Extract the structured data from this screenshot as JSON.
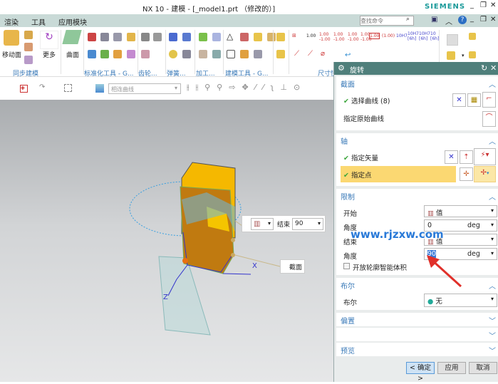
{
  "window": {
    "title": "NX 10 - 建模 - [_model1.prt （修改的）]",
    "brand": "SIEMENS"
  },
  "menu": {
    "items": [
      "渲染",
      "工具",
      "应用模块"
    ],
    "search_placeholder": "查找命令"
  },
  "ribbon": {
    "move_face": "移动面",
    "more": "更多",
    "surface": "曲面",
    "groups": [
      "同步建模",
      "标准化工具 - G...",
      "齿轮...",
      "弹簧...",
      "加工...",
      "建模工具 - G...",
      "尺寸快"
    ]
  },
  "toolbar2": {
    "curve_rule": "相连曲线"
  },
  "viewport": {
    "end_label": "结束",
    "end_value": "90",
    "section_label": "截面",
    "axis_x": "X",
    "axis_z": "Z"
  },
  "dialog": {
    "title": "旋转",
    "section": {
      "header": "截面",
      "select_curve": "选择曲线 (8)",
      "specify_origin_curve": "指定原始曲线"
    },
    "axis": {
      "header": "轴",
      "specify_vector": "指定矢量",
      "specify_point": "指定点"
    },
    "limits": {
      "header": "限制",
      "start_label": "开始",
      "start_type": "值",
      "start_angle_label": "角度",
      "start_angle": "0",
      "unit": "deg",
      "end_label": "结束",
      "end_type": "值",
      "end_angle_label": "角度",
      "end_angle": "90",
      "open_profile": "开放轮廓智能体积"
    },
    "boolean": {
      "header": "布尔",
      "label": "布尔",
      "value": "无"
    },
    "offset": {
      "header": "偏置"
    },
    "preview": {
      "header": "预览"
    },
    "buttons": {
      "ok": "< 确定 >",
      "apply": "应用",
      "cancel": "取消"
    }
  },
  "watermark": "www.rjzxw.com",
  "colors": {
    "accent": "#4f7f7b",
    "link": "#3a7ab8",
    "highlight": "#fbd872",
    "solid": "#f4b400"
  }
}
